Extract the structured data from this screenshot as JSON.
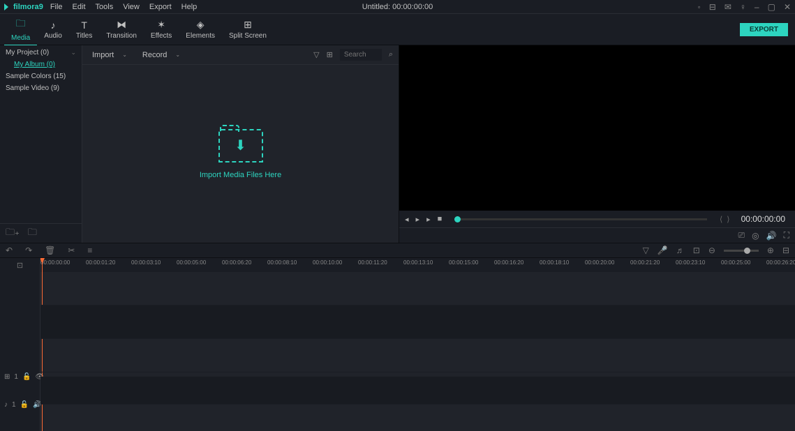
{
  "app": {
    "name": "filmora",
    "version": "9",
    "title": "Untitled:",
    "timecode": "00:00:00:00"
  },
  "menu": [
    "File",
    "Edit",
    "Tools",
    "View",
    "Export",
    "Help"
  ],
  "tabs": [
    {
      "label": "Media",
      "icon": "folder"
    },
    {
      "label": "Audio",
      "icon": "music"
    },
    {
      "label": "Titles",
      "icon": "text"
    },
    {
      "label": "Transition",
      "icon": "transition"
    },
    {
      "label": "Effects",
      "icon": "effects"
    },
    {
      "label": "Elements",
      "icon": "elements"
    },
    {
      "label": "Split Screen",
      "icon": "split"
    }
  ],
  "export_label": "EXPORT",
  "tree": [
    {
      "label": "My Project (0)",
      "has_children": true
    },
    {
      "label": "My Album (0)",
      "child": true
    },
    {
      "label": "Sample Colors (15)"
    },
    {
      "label": "Sample Video (9)"
    }
  ],
  "media_bar": {
    "import": "Import",
    "record": "Record",
    "search_placeholder": "Search"
  },
  "drop_text": "Import Media Files Here",
  "preview": {
    "time": "00:00:00:00"
  },
  "ruler_marks": [
    "00:00:00:00",
    "00:00:01:20",
    "00:00:03:10",
    "00:00:05:00",
    "00:00:06:20",
    "00:00:08:10",
    "00:00:10:00",
    "00:00:11:20",
    "00:00:13:10",
    "00:00:15:00",
    "00:00:16:20",
    "00:00:18:10",
    "00:00:20:00",
    "00:00:21:20",
    "00:00:23:10",
    "00:00:25:00",
    "00:00:26:20"
  ],
  "tracks": {
    "video": "1",
    "audio": "1"
  }
}
